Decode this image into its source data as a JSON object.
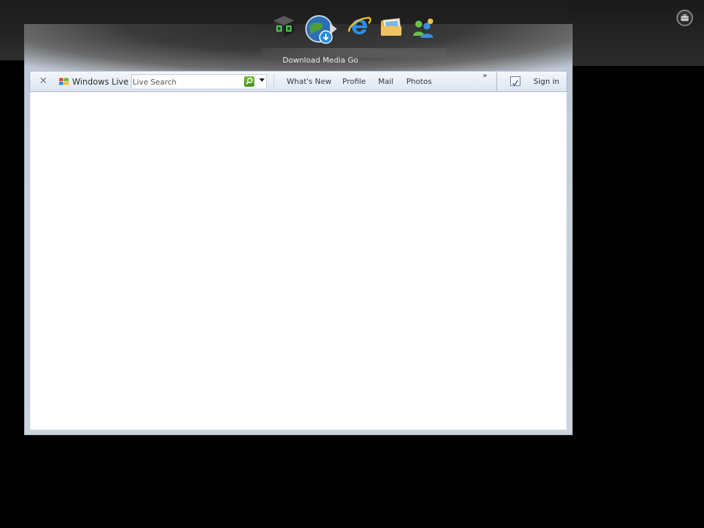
{
  "dock": {
    "caption": "Download Media Go",
    "icons": [
      "media-cube-icon",
      "media-go-globe-icon",
      "internet-explorer-icon",
      "photo-folder-icon",
      "messenger-icon"
    ]
  },
  "toolbar": {
    "close_symbol": "✕",
    "brand_label": "Windows Live",
    "search_placeholder": "Live Search",
    "links": {
      "whats_new": "What's New",
      "profile": "Profile",
      "mail": "Mail",
      "photos": "Photos"
    },
    "more_symbol": "»",
    "sign_in": "Sign in"
  }
}
